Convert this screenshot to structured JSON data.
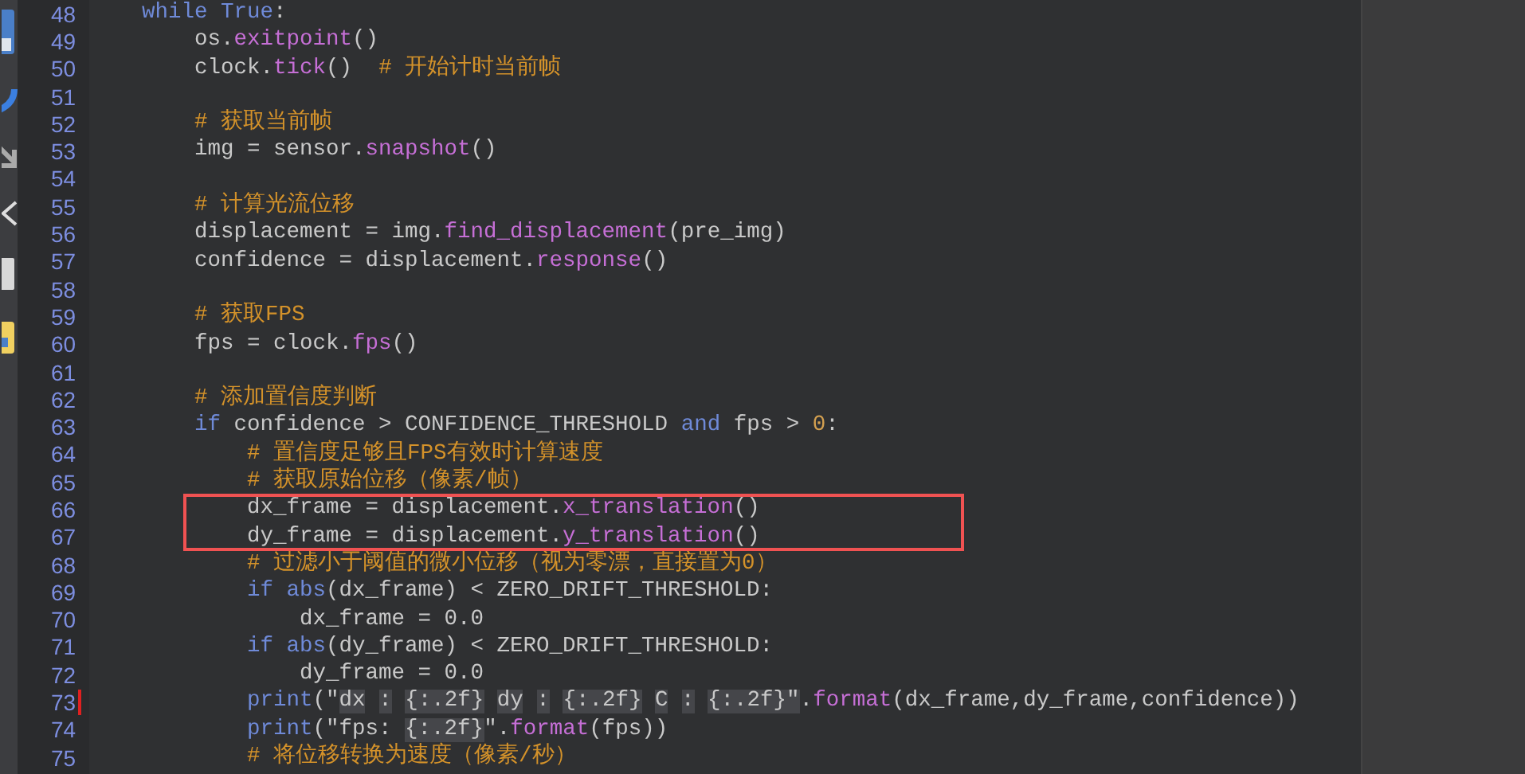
{
  "editor": {
    "lines": [
      {
        "number": "48",
        "marked": false,
        "tokens": [
          {
            "text": "while True",
            "kind": "keyword"
          },
          {
            "text": ":",
            "kind": "plain"
          }
        ],
        "children": [
          {
            "number": "49",
            "marked": false,
            "tokens": [
              {
                "text": "os.",
                "kind": "plain"
              },
              {
                "text": "exitpoint",
                "kind": "method"
              },
              {
                "text": "()",
                "kind": "plain"
              }
            ]
          },
          {
            "number": "50",
            "marked": false,
            "tokens": [
              {
                "text": "clock.",
                "kind": "plain"
              },
              {
                "text": "tick",
                "kind": "method"
              },
              {
                "text": "()",
                "kind": "plain"
              },
              {
                "text": "# 开始计时当前帧",
                "kind": "comment"
              }
            ]
          },
          {
            "number": "51",
            "marked": false
          },
          {
            "number": "52",
            "marked": false,
            "tokens": [
              {
                "text": "# 获取当前帧",
                "kind": "comment"
              }
            ]
          },
          {
            "number": "53",
            "marked": false,
            "tokens": [
              {
                "text": "img = sensor.",
                "kind": "plain"
              },
              {
                "text": "snapshot",
                "kind": "method"
              },
              {
                "text": "()",
                "kind": "plain"
              }
            ]
          },
          {
            "number": "54",
            "marked": false
          },
          {
            "number": "55",
            "marked": false,
            "tokens": [
              {
                "text": "# 计算光流位移",
                "kind": "comment"
              }
            ]
          },
          {
            "number": "56",
            "marked": false,
            "tokens": [
              {
                "text": "displacement = img.",
                "kind": "plain"
              },
              {
                "text": "find_displacement",
                "kind": "method"
              },
              {
                "text": "(pre_img)",
                "kind": "plain"
              }
            ]
          },
          {
            "number": "57",
            "marked": false,
            "tokens": [
              {
                "text": "confidence = displacement.",
                "kind": "plain"
              },
              {
                "text": "response",
                "kind": "method"
              },
              {
                "text": "()",
                "kind": "plain"
              }
            ]
          },
          {
            "number": "58",
            "marked": false
          },
          {
            "number": "59",
            "marked": false,
            "tokens": [
              {
                "text": "# 获取FPS",
                "kind": "comment"
              }
            ]
          },
          {
            "number": "60",
            "marked": false,
            "tokens": [
              {
                "text": "fps = clock.",
                "kind": "plain"
              },
              {
                "text": "fps",
                "kind": "method"
              },
              {
                "text": "()",
                "kind": "plain"
              }
            ]
          },
          {
            "number": "61",
            "marked": false
          },
          {
            "number": "62",
            "marked": false,
            "tokens": [
              {
                "text": "# 添加置信度判断",
                "kind": "comment"
              }
            ]
          },
          {
            "number": "63",
            "marked": false,
            "tokens": [
              {
                "text": "if",
                "kind": "keyword"
              },
              {
                "text": " confidence > CONFIDENCE_THRESHOLD ",
                "kind": "plain"
              },
              {
                "text": "and",
                "kind": "keyword"
              },
              {
                "text": " fps > ",
                "kind": "plain"
              },
              {
                "text": "0",
                "kind": "number"
              },
              {
                "text": ":",
                "kind": "plain"
              }
            ],
            "children": [
              {
                "number": "64",
                "marked": false,
                "tokens": [
                  {
                    "text": "# 置信度足够且FPS有效时计算速度",
                    "kind": "comment"
                  }
                ]
              },
              {
                "number": "65",
                "marked": false,
                "tokens": [
                  {
                    "text": "# 获取原始位移（像素/帧）",
                    "kind": "comment"
                  }
                ]
              },
              {
                "number": "66",
                "marked": false,
                "tokens": [
                  {
                    "text": "dx_frame = displacement.",
                    "kind": "plain"
                  },
                  {
                    "text": "x_translation",
                    "kind": "method"
                  },
                  {
                    "text": "()",
                    "kind": "plain"
                  }
                ]
              },
              {
                "number": "67",
                "marked": false,
                "tokens": [
                  {
                    "text": "dy_frame = displacement.",
                    "kind": "plain"
                  },
                  {
                    "text": "y_translation",
                    "kind": "method"
                  },
                  {
                    "text": "()",
                    "kind": "plain"
                  }
                ]
              },
              {
                "number": "68",
                "marked": false,
                "tokens": [
                  {
                    "text": "# 过滤小于阈值的微小位移（视为零漂，直接置为0）",
                    "kind": "comment"
                  }
                ]
              },
              {
                "number": "69",
                "marked": false,
                "tokens": [
                  {
                    "text": "if abs",
                    "kind": "keyword"
                  },
                  {
                    "text": "(dx_frame) < ZERO_DRIFT_THRESHOLD:",
                    "kind": "plain"
                  }
                ],
                "children": [
                  {
                    "number": "70",
                    "marked": false,
                    "tokens": [
                      {
                        "text": "dx_frame = 0.0",
                        "kind": "plain"
                      }
                    ]
                  }
                ]
              },
              {
                "number": "71",
                "marked": false,
                "tokens": [
                  {
                    "text": "if abs",
                    "kind": "keyword"
                  },
                  {
                    "text": "(dy_frame) < ZERO_DRIFT_THRESHOLD:",
                    "kind": "plain"
                  }
                ],
                "children": [
                  {
                    "number": "72",
                    "marked": false,
                    "tokens": [
                      {
                        "text": "dy_frame = 0.0",
                        "kind": "plain"
                      }
                    ]
                  }
                ]
              },
              {
                "number": "73",
                "marked": true,
                "tokens": [
                  {
                    "text": "print",
                    "kind": "keyword"
                  },
                  {
                    "text": "(\"",
                    "kind": "plain"
                  },
                  {
                    "text": "dx : {:.2f} dy : {:.2f} C : {:.2f}\"",
                    "kind": "match"
                  },
                  {
                    "text": ".",
                    "kind": "plain"
                  },
                  {
                    "text": "format",
                    "kind": "method"
                  },
                  {
                    "text": "(dx_frame,dy_frame,confidence))",
                    "kind": "plain"
                  }
                ]
              },
              {
                "number": "74",
                "marked": false,
                "tokens": [
                  {
                    "text": "print",
                    "kind": "keyword"
                  },
                  {
                    "text": "(\"fps:",
                    "kind": "plain"
                  },
                  {
                    "text": "{:.2f}",
                    "kind": "match"
                  },
                  {
                    "text": "\".",
                    "kind": "plain"
                  },
                  {
                    "text": "format",
                    "kind": "method"
                  },
                  {
                    "text": "(fps))",
                    "kind": "plain"
                  }
                ]
              },
              {
                "number": "75",
                "marked": false,
                "tokens": [
                  {
                    "text": "# 将位移转换为速度（像素/秒）",
                    "kind": "comment"
                  }
                ]
              }
            ]
          }
        ]
      }
    ]
  }
}
